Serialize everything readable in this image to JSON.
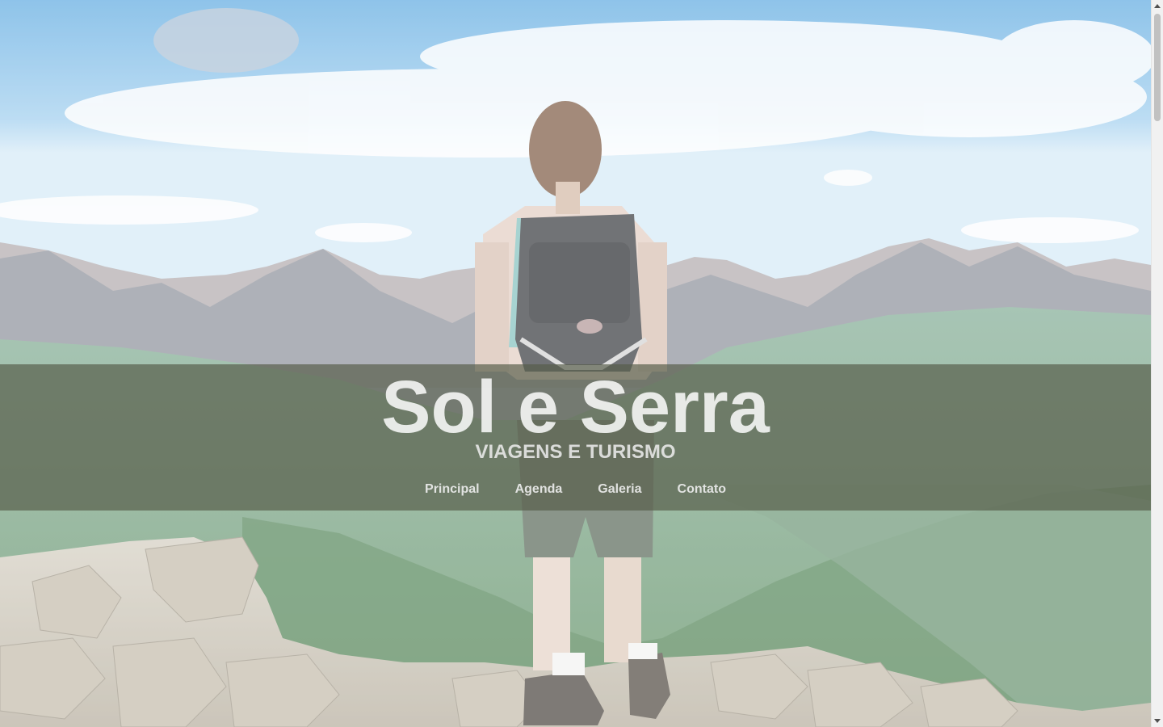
{
  "site": {
    "title": "Sol e Serra",
    "subtitle": "VIAGENS E TURISMO"
  },
  "nav": {
    "items": [
      {
        "label": "Principal"
      },
      {
        "label": "Agenda"
      },
      {
        "label": "Galeria"
      },
      {
        "label": "Contato"
      }
    ]
  },
  "hero": {
    "image": "hiker-with-backpack-on-mountain-summit",
    "banner_color": "#565c48"
  },
  "scrollbar": {
    "icons": [
      "scroll-up-arrow-icon",
      "scroll-down-arrow-icon"
    ]
  }
}
